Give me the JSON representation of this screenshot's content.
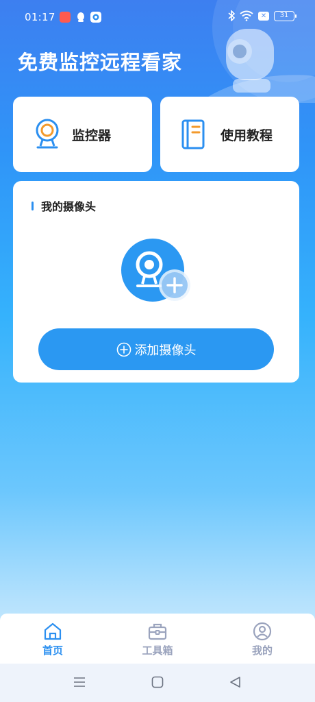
{
  "status_bar": {
    "time": "01:17",
    "battery": "31",
    "icons": [
      "bluetooth-icon",
      "wifi-icon",
      "notification-x-icon",
      "battery-icon"
    ],
    "app_icons": [
      "red-app-icon",
      "qq-icon",
      "camera-app-icon"
    ]
  },
  "header": {
    "title": "免费监控远程看家"
  },
  "features": {
    "monitor": {
      "label": "监控器",
      "icon": "webcam-icon"
    },
    "tutorial": {
      "label": "使用教程",
      "icon": "book-icon"
    }
  },
  "camera_section": {
    "title": "我的摄像头",
    "empty_icon": "webcam-add-icon",
    "add_button_label": "添加摄像头"
  },
  "tabs": [
    {
      "label": "首页",
      "icon": "home-icon",
      "active": true
    },
    {
      "label": "工具箱",
      "icon": "toolbox-icon",
      "active": false
    },
    {
      "label": "我的",
      "icon": "user-icon",
      "active": false
    }
  ],
  "nav": [
    "menu-icon",
    "home-square-icon",
    "back-triangle-icon"
  ],
  "colors": {
    "accent": "#2b8ff0",
    "button": "#2b98f2",
    "orange_accent": "#f39a2c",
    "inactive_tab": "#9aa3bd"
  }
}
